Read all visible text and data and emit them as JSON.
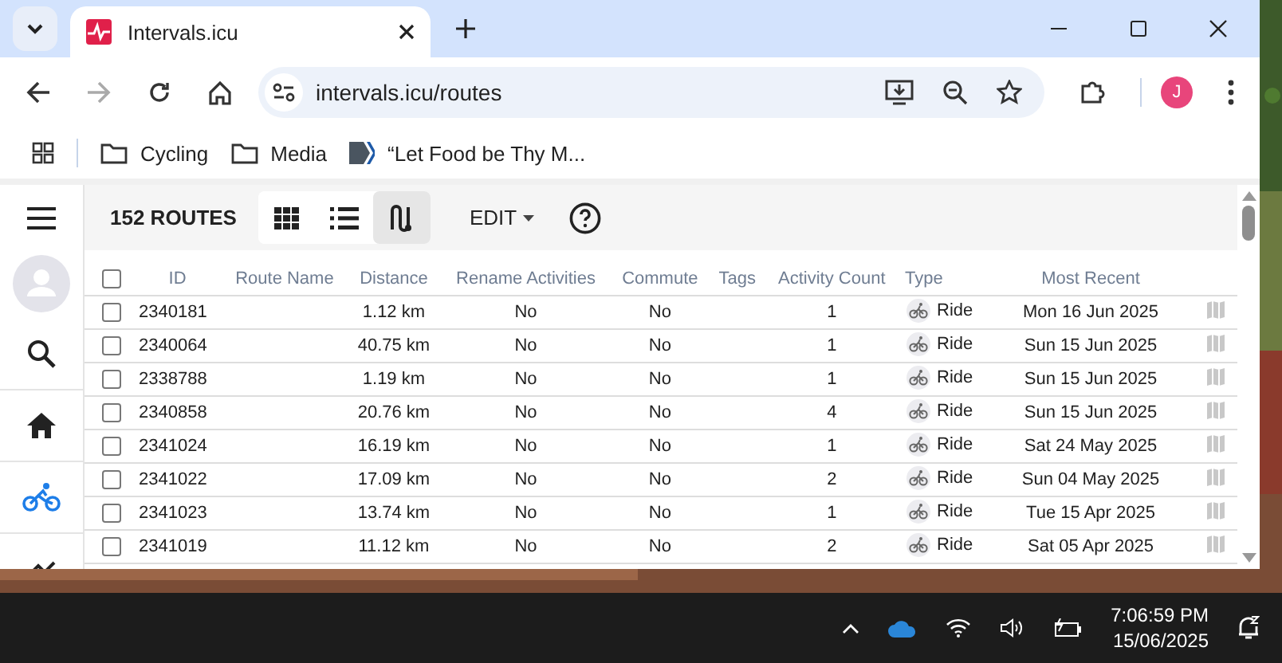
{
  "browser": {
    "tab_title": "Intervals.icu",
    "address": "intervals.icu/routes",
    "profile_initial": "J",
    "bookmarks": [
      {
        "kind": "folder",
        "label": "Cycling"
      },
      {
        "kind": "folder",
        "label": "Media"
      },
      {
        "kind": "page",
        "label": "“Let Food be Thy M..."
      }
    ]
  },
  "sidebar": {
    "items": [
      {
        "kind": "search",
        "selected": false
      },
      {
        "kind": "home",
        "selected": false
      },
      {
        "kind": "bike",
        "selected": true
      },
      {
        "kind": "chart",
        "selected": false
      }
    ]
  },
  "toolbar": {
    "count": "152 ROUTES",
    "views": [
      {
        "kind": "grid",
        "selected": false
      },
      {
        "kind": "list",
        "selected": false
      },
      {
        "kind": "route",
        "selected": true
      }
    ],
    "edit": "EDIT"
  },
  "table": {
    "select_all_checked": false,
    "columns": [
      "ID",
      "Route Name",
      "Distance",
      "Rename Activities",
      "Commute",
      "Tags",
      "Activity Count",
      "Type",
      "Most Recent"
    ],
    "rows": [
      {
        "checked": false,
        "id": "2340181",
        "distance": "1.12 km",
        "rename": "No",
        "commute": "No",
        "count": "1",
        "type": "Ride",
        "recent": "Mon 16 Jun 2025"
      },
      {
        "checked": false,
        "id": "2340064",
        "distance": "40.75 km",
        "rename": "No",
        "commute": "No",
        "count": "1",
        "type": "Ride",
        "recent": "Sun 15 Jun 2025"
      },
      {
        "checked": false,
        "id": "2338788",
        "distance": "1.19 km",
        "rename": "No",
        "commute": "No",
        "count": "1",
        "type": "Ride",
        "recent": "Sun 15 Jun 2025"
      },
      {
        "checked": false,
        "id": "2340858",
        "distance": "20.76 km",
        "rename": "No",
        "commute": "No",
        "count": "4",
        "type": "Ride",
        "recent": "Sun 15 Jun 2025"
      },
      {
        "checked": false,
        "id": "2341024",
        "distance": "16.19 km",
        "rename": "No",
        "commute": "No",
        "count": "1",
        "type": "Ride",
        "recent": "Sat 24 May 2025"
      },
      {
        "checked": false,
        "id": "2341022",
        "distance": "17.09 km",
        "rename": "No",
        "commute": "No",
        "count": "2",
        "type": "Ride",
        "recent": "Sun 04 May 2025"
      },
      {
        "checked": false,
        "id": "2341023",
        "distance": "13.74 km",
        "rename": "No",
        "commute": "No",
        "count": "1",
        "type": "Ride",
        "recent": "Tue 15 Apr 2025"
      },
      {
        "checked": false,
        "id": "2341019",
        "distance": "11.12 km",
        "rename": "No",
        "commute": "No",
        "count": "2",
        "type": "Ride",
        "recent": "Sat 05 Apr 2025"
      }
    ]
  },
  "taskbar": {
    "time": "7:06:59 PM",
    "date": "15/06/2025"
  }
}
